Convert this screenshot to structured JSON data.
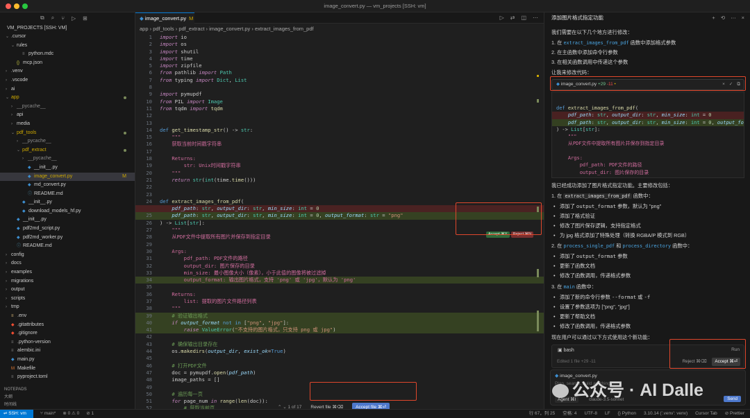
{
  "window": {
    "title": "image_convert.py — vm_projects [SSH: vm]"
  },
  "sidebar": {
    "icons": [
      "files-icon",
      "search-icon",
      "source-control-icon",
      "run-debug-icon",
      "extensions-icon"
    ],
    "project_label": "VM_PROJECTS [SSH: VM]",
    "tree": [
      {
        "label": ".cursor",
        "depth": 0,
        "type": "folder-open"
      },
      {
        "label": "rules",
        "depth": 1,
        "type": "folder-open"
      },
      {
        "label": "python.mdc",
        "depth": 2,
        "type": "file"
      },
      {
        "label": "mcp.json",
        "depth": 1,
        "type": "json"
      },
      {
        "label": ".venv",
        "depth": 0,
        "type": "folder"
      },
      {
        "label": ".vscode",
        "depth": 0,
        "type": "folder"
      },
      {
        "label": "ai",
        "depth": 0,
        "type": "folder"
      },
      {
        "label": "app",
        "depth": 0,
        "type": "folder-open",
        "color": "#cca700",
        "dot": true
      },
      {
        "label": "__pycache__",
        "depth": 1,
        "type": "folder",
        "dim": true
      },
      {
        "label": "api",
        "depth": 1,
        "type": "folder"
      },
      {
        "label": "media",
        "depth": 1,
        "type": "folder"
      },
      {
        "label": "pdf_tools",
        "depth": 1,
        "type": "folder-open",
        "color": "#cca700",
        "dot": true
      },
      {
        "label": "__pycache__",
        "depth": 2,
        "type": "folder",
        "dim": true
      },
      {
        "label": "pdf_extract",
        "depth": 2,
        "type": "folder-open",
        "color": "#cca700",
        "dot": true
      },
      {
        "label": "__pycache__",
        "depth": 3,
        "type": "folder",
        "dim": true
      },
      {
        "label": "__init__.py",
        "depth": 3,
        "type": "py"
      },
      {
        "label": "image_convert.py",
        "depth": 3,
        "type": "py",
        "active": true,
        "badge": "M",
        "color": "#cca700"
      },
      {
        "label": "md_convert.py",
        "depth": 3,
        "type": "py"
      },
      {
        "label": "README.md",
        "depth": 3,
        "type": "md"
      },
      {
        "label": "__init__.py",
        "depth": 2,
        "type": "py"
      },
      {
        "label": "download_models_hf.py",
        "depth": 2,
        "type": "py"
      },
      {
        "label": "__init__.py",
        "depth": 1,
        "type": "py"
      },
      {
        "label": "pdf2md_script.py",
        "depth": 1,
        "type": "py"
      },
      {
        "label": "pdf2md_worker.py",
        "depth": 1,
        "type": "py"
      },
      {
        "label": "README.md",
        "depth": 1,
        "type": "md"
      },
      {
        "label": "config",
        "depth": 0,
        "type": "folder"
      },
      {
        "label": "docs",
        "depth": 0,
        "type": "folder"
      },
      {
        "label": "examples",
        "depth": 0,
        "type": "folder"
      },
      {
        "label": "migrations",
        "depth": 0,
        "type": "folder"
      },
      {
        "label": "output",
        "depth": 0,
        "type": "folder"
      },
      {
        "label": "scripts",
        "depth": 0,
        "type": "folder"
      },
      {
        "label": "tmp",
        "depth": 0,
        "type": "folder"
      },
      {
        "label": ".env",
        "depth": 0,
        "type": "env"
      },
      {
        "label": ".gitattributes",
        "depth": 0,
        "type": "git"
      },
      {
        "label": ".gitignore",
        "depth": 0,
        "type": "git"
      },
      {
        "label": ".python-version",
        "depth": 0,
        "type": "file"
      },
      {
        "label": "alembic.ini",
        "depth": 0,
        "type": "file"
      },
      {
        "label": "main.py",
        "depth": 0,
        "type": "py"
      },
      {
        "label": "Makefile",
        "depth": 0,
        "type": "make"
      },
      {
        "label": "pyproject.toml",
        "depth": 0,
        "type": "file"
      }
    ],
    "outline": [
      "NOTEPADS",
      "大纲",
      "时间线"
    ]
  },
  "editor": {
    "tab": {
      "label": "image_convert.py",
      "modified": "M"
    },
    "breadcrumb": [
      "app",
      "pdf_tools",
      "pdf_extract",
      "image_convert.py",
      "extract_images_from_pdf"
    ],
    "accept_chip": {
      "accept": "Accept ⌘Y",
      "reject": "Reject ⌘N"
    },
    "review": {
      "count": "1 of 17",
      "revert": "Revert file ⌘⌫",
      "accept": "Accept file ⌘⏎"
    }
  },
  "code_lines": [
    {
      "n": "1",
      "h": "<span class='kw'>import</span> io"
    },
    {
      "n": "2",
      "h": "<span class='kw'>import</span> os"
    },
    {
      "n": "3",
      "h": "<span class='kw'>import</span> shutil"
    },
    {
      "n": "4",
      "h": "<span class='kw'>import</span> time"
    },
    {
      "n": "5",
      "h": "<span class='kw'>import</span> zipfile"
    },
    {
      "n": "6",
      "h": "<span class='kw'>from</span> pathlib <span class='kw'>import</span> <span class='ty'>Path</span>"
    },
    {
      "n": "7",
      "h": "<span class='kw'>from</span> typing <span class='kw'>import</span> <span class='ty'>Dict</span>, <span class='ty'>List</span>"
    },
    {
      "n": "8",
      "h": ""
    },
    {
      "n": "9",
      "h": "<span class='kw'>import</span> pymupdf"
    },
    {
      "n": "10",
      "h": "<span class='kw'>from</span> PIL <span class='kw'>import</span> <span class='ty'>Image</span>"
    },
    {
      "n": "11",
      "h": "<span class='kw'>from</span> tqdm <span class='kw'>import</span> <span class='fn'>tqdm</span>"
    },
    {
      "n": "12",
      "h": ""
    },
    {
      "n": "13",
      "h": ""
    },
    {
      "n": "14",
      "h": "<span class='kb'>def</span> <span class='fn'>get_timestamp_str</span>() -> <span class='ty'>str</span>:"
    },
    {
      "n": "15",
      "h": "    <span class='zh'>\"\"\"</span>"
    },
    {
      "n": "16",
      "h": "    <span class='zh'>获取当前时间戳字符串</span>"
    },
    {
      "n": "17",
      "h": ""
    },
    {
      "n": "18",
      "h": "    <span class='zh'>Returns:</span>"
    },
    {
      "n": "19",
      "h": "        <span class='zh'>str: Unix时间戳字符串</span>"
    },
    {
      "n": "20",
      "h": "    <span class='zh'>\"\"\"</span>"
    },
    {
      "n": "21",
      "h": "    <span class='kw'>return</span> <span class='ty'>str</span>(<span class='ty'>int</span>(time.<span class='fn'>time</span>()))"
    },
    {
      "n": "22",
      "h": ""
    },
    {
      "n": "23",
      "h": ""
    },
    {
      "n": "24",
      "h": "<span class='kb'>def</span> <span class='fn'>extract_images_from_pdf</span>("
    },
    {
      "n": "",
      "h": "    <span class='pa'>pdf_path</span>: <span class='ty'>str</span>, <span class='pa'>output_dir</span>: <span class='ty'>str</span>, <span class='pa'>min_size</span>: <span class='ty'>int</span> = <span class='nm'>0</span>",
      "cls": "del"
    },
    {
      "n": "25",
      "h": "    <span class='pa'>pdf_path</span>: <span class='ty'>str</span>, <span class='pa'>output_dir</span>: <span class='ty'>str</span>, <span class='pa'>min_size</span>: <span class='ty'>int</span> = <span class='nm'>0</span>, <span class='pa'>output_format</span>: <span class='ty'>str</span> = <span class='st'>\"png\"</span>",
      "cls": "add"
    },
    {
      "n": "26",
      "h": ") -> <span class='ty'>List</span>[<span class='ty'>str</span>]:"
    },
    {
      "n": "27",
      "h": "    <span class='zh'>\"\"\"</span>"
    },
    {
      "n": "28",
      "h": "    <span class='zh'>从PDF文件中提取所有图片并保存到指定目录</span>"
    },
    {
      "n": "29",
      "h": ""
    },
    {
      "n": "30",
      "h": "    <span class='zh'>Args:</span>"
    },
    {
      "n": "31",
      "h": "        <span class='zh'>pdf_path: PDF文件的路径</span>"
    },
    {
      "n": "32",
      "h": "        <span class='zh'>output_dir: 图片保存的目录</span>"
    },
    {
      "n": "33",
      "h": "        <span class='zh'>min_size: 最小图像大小（像素），小于此值的图像将被过滤掉</span>"
    },
    {
      "n": "34",
      "h": "        <span class='zh'>output_format: 输出图片格式，支持 'png' 或 'jpg'，默认为 'png'</span>",
      "cls": "add"
    },
    {
      "n": "35",
      "h": ""
    },
    {
      "n": "36",
      "h": "    <span class='zh'>Returns:</span>"
    },
    {
      "n": "37",
      "h": "        <span class='zh'>list: 提取的图片文件路径列表</span>"
    },
    {
      "n": "38",
      "h": "    <span class='zh'>\"\"\"</span>"
    },
    {
      "n": "39",
      "h": "    <span class='cm'># 验证输出格式</span>",
      "cls": "add"
    },
    {
      "n": "40",
      "h": "    <span class='kw'>if</span> <span class='pa'>output_format</span> <span class='kb'>not in</span> [<span class='st'>\"png\"</span>, <span class='st'>\"jpg\"</span>]:",
      "cls": "add"
    },
    {
      "n": "41",
      "h": "        <span class='kw'>raise</span> <span class='ty'>ValueError</span>(<span class='st'>\"不支持的图片格式，只支持 png 或 jpg\"</span>)",
      "cls": "add"
    },
    {
      "n": "42",
      "h": ""
    },
    {
      "n": "43",
      "h": "    <span class='cm'># 确保输出目录存在</span>"
    },
    {
      "n": "44",
      "h": "    os.<span class='fn'>makedirs</span>(<span class='pa'>output_dir</span>, <span class='pa'>exist_ok</span>=<span class='kb'>True</span>)"
    },
    {
      "n": "45",
      "h": ""
    },
    {
      "n": "46",
      "h": "    <span class='cm'># 打开PDF文件</span>"
    },
    {
      "n": "47",
      "h": "    doc = pymupdf.<span class='fn'>open</span>(<span class='pa'>pdf_path</span>)"
    },
    {
      "n": "48",
      "h": "    image_paths = []"
    },
    {
      "n": "49",
      "h": ""
    },
    {
      "n": "50",
      "h": "    <span class='cm'># 遍历每一页</span>"
    },
    {
      "n": "51",
      "h": "    <span class='kw'>for</span> page_num <span class='kw'>in</span> <span class='fn'>range</span>(<span class='fn'>len</span>(doc)):"
    },
    {
      "n": "52",
      "h": "        <span class='cm'># 获取当前页</span>"
    }
  ],
  "chat": {
    "header": "添加图片格式指定功能",
    "intro": "我们需要在以下几个地方进行修改：",
    "steps": [
      {
        "pre": "1. 在 ",
        "code": "extract_images_from_pdf",
        "post": " 函数中添加格式参数"
      },
      {
        "pre": "2. 在主函数中添加命令行参数",
        "code": "",
        "post": ""
      },
      {
        "pre": "3. 在相关函数调用中传递这个参数",
        "code": "",
        "post": ""
      }
    ],
    "lets": "让我来修改代码：",
    "file_card": {
      "name": "image_convert.py",
      "plus": "+29",
      "minus": "-11",
      "dot": "•"
    },
    "diff": [
      {
        "h": "<span class='kb'>def</span> <span class='fn'>extract_images_from_pdf</span>(",
        "cls": ""
      },
      {
        "h": "    <span class='pa'>pdf_path</span>: <span class='ty'>str</span>, <span class='pa'>output_dir</span>: <span class='ty'>str</span>, <span class='pa'>min_size</span>: <span class='ty'>int</span> = <span class='nm'>0</span>",
        "cls": "del"
      },
      {
        "h": "    <span class='pa'>pdf_path</span>: <span class='ty'>str</span>, <span class='pa'>output_dir</span>: <span class='ty'>str</span>, <span class='pa'>min_size</span>: <span class='ty'>int</span> = <span class='nm'>0</span>, <span class='pa'>output_for</span>",
        "cls": "add"
      },
      {
        "h": ") -> <span class='ty'>List</span>[<span class='ty'>str</span>]:",
        "cls": ""
      },
      {
        "h": "    <span class='zh'>\"\"\"</span>",
        "cls": ""
      },
      {
        "h": "    <span class='zh'>从PDF文件中提取所有图片并保存到指定目录</span>",
        "cls": ""
      },
      {
        "h": "",
        "cls": ""
      },
      {
        "h": "    <span class='zh'>Args:</span>",
        "cls": ""
      },
      {
        "h": "        <span class='zh'>pdf_path: PDF文件的路径</span>",
        "cls": ""
      },
      {
        "h": "        <span class='zh'>output_dir: 图片保存的目录</span>",
        "cls": ""
      }
    ],
    "summary": "我已经成功添加了图片格式指定功能。主要修改包括：",
    "s1": {
      "pre": "1. 在 ",
      "code": "extract_images_from_pdf",
      "post": " 函数中："
    },
    "s1_items": [
      {
        "pre": "添加了 ",
        "code": "output_format",
        "post": " 参数，默认为 \"png\""
      },
      {
        "pre": "添加了格式验证",
        "code": "",
        "post": ""
      },
      {
        "pre": "修改了图片保存逻辑，支持指定格式",
        "code": "",
        "post": ""
      },
      {
        "pre": "为 jpg 格式添加了特殊处理（转换 RGBA/P 模式到 RGB）",
        "code": "",
        "post": ""
      }
    ],
    "s2": {
      "pre": "2. 在 ",
      "code1": "process_single_pdf",
      "mid": " 和 ",
      "code2": "process_directory",
      "post": " 函数中："
    },
    "s2_items": [
      {
        "pre": "添加了 ",
        "code": "output_format",
        "post": " 参数"
      },
      {
        "pre": "更新了函数文档",
        "code": "",
        "post": ""
      },
      {
        "pre": "修改了函数调用，传递格式参数",
        "code": "",
        "post": ""
      }
    ],
    "s3": {
      "pre": "3. 在 ",
      "code": "main",
      "post": " 函数中："
    },
    "s3_items": [
      {
        "pre": "添加了新的命令行参数 ",
        "code": "--format",
        "post": " 或 ",
        "code2": "-f"
      },
      {
        "pre": "设置了参数选项为 [\"png\", \"jpg\"]",
        "code": "",
        "post": ""
      },
      {
        "pre": "更新了帮助文档",
        "code": "",
        "post": ""
      },
      {
        "pre": "修改了函数调用，传递格式参数",
        "code": "",
        "post": ""
      }
    ],
    "closing": "现在用户可以通过以下方式使用这个新功能：",
    "bash": {
      "label": "bash",
      "run": "Run"
    },
    "edited": {
      "label": "Edited 1 file +29 -11",
      "reject": "Reject ⌘⌫",
      "accept": "Accept ⌘⏎"
    },
    "input": {
      "file": "image_convert.py",
      "placeholder": "Plan, search, build anything",
      "agent": "Agent ⌘I",
      "model": "claude-3.5-sonnet",
      "send": "Send"
    }
  },
  "watermark": "公众号 · AI Dalle",
  "statusbar": {
    "remote": "SSH: vm",
    "left": [
      "main*",
      "⊗ 0 ⚠ 0",
      "⊘ 1"
    ],
    "right": [
      "行 67，列 25",
      "空格: 4",
      "UTF-8",
      "LF",
      "{} Python",
      "3.10.14 ('.venv': venv)",
      "Cursor Tab",
      "⊘ Prettier"
    ]
  },
  "colors": {
    "accent": "#0078d4",
    "modified": "#cca700",
    "highlight_box": "#e0472c",
    "accept_button": "#4d78cc"
  }
}
